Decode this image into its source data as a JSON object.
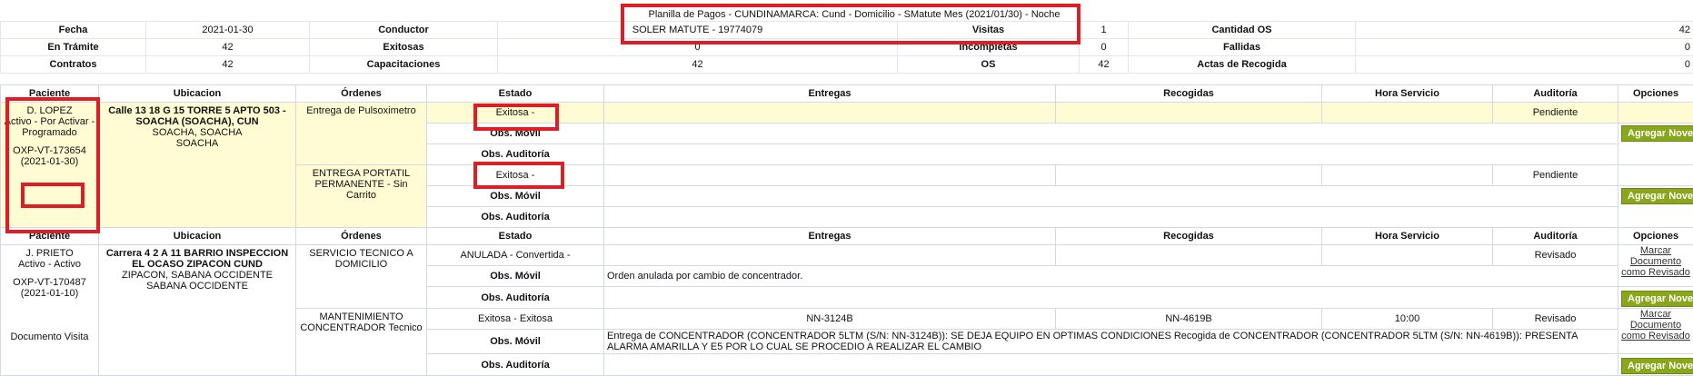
{
  "summary": {
    "title": "Planilla de Pagos - CUNDINAMARCA: Cund - Domicilio - SMatute Mes (2021/01/30) - Noche",
    "rows": [
      [
        "Fecha",
        "2021-01-30",
        "Conductor",
        "SOLER MATUTE - 19774079",
        "Visitas",
        "1",
        "Cantidad OS",
        "42"
      ],
      [
        "En Trámite",
        "42",
        "Exitosas",
        "0",
        "Incompletas",
        "0",
        "Fallidas",
        "0"
      ],
      [
        "Contratos",
        "42",
        "Capacitaciones",
        "42",
        "OS",
        "42",
        "Actas de Recogida",
        "0"
      ]
    ]
  },
  "headers": [
    "Paciente",
    "Ubicacion",
    "Órdenes",
    "Estado",
    "Entregas",
    "Recogidas",
    "Hora Servicio",
    "Auditoría",
    "Opciones"
  ],
  "obs_movil_label": "Obs. Móvil",
  "obs_auditoria_label": "Obs. Auditoría",
  "patients": [
    {
      "name": "D. LOPEZ",
      "status": "Activo - Por Activar - Programado",
      "code": "OXP-VT-173654",
      "date": "(2021-01-30)",
      "address_bold": "Calle 13 18 G 15 TORRE 5 APTO 503 - SOACHA (SOACHA), CUN",
      "address_city": "SOACHA, SOACHA",
      "address_region": "SOACHA",
      "orders": [
        {
          "name": "Entrega de Pulsoximetro",
          "estado": "Exitosa -",
          "entregas": "",
          "recogidas": "",
          "hora": "",
          "auditoria": "Pendiente",
          "obs_movil": "",
          "button": "Agregar Novedad"
        },
        {
          "name": "ENTREGA PORTATIL PERMANENTE - Sin Carrito",
          "estado": "Exitosa -",
          "entregas": "",
          "recogidas": "",
          "hora": "",
          "auditoria": "Pendiente",
          "obs_movil": "",
          "button": "Agregar Novedad"
        }
      ]
    },
    {
      "name": "J. PRIETO",
      "status": "Activo - Activo",
      "code": "OXP-VT-170487",
      "date": "(2021-01-10)",
      "doc": "Documento Visita",
      "address_bold": "Carrera 4 2 A 11 BARRIO INSPECCION EL OCASO ZIPACON CUND",
      "address_city": "ZIPACON, SABANA OCCIDENTE",
      "address_region": "SABANA OCCIDENTE",
      "orders": [
        {
          "name": "SERVICIO TECNICO A DOMICILIO",
          "estado": "ANULADA - Convertida -",
          "entregas": "",
          "recogidas": "",
          "hora": "",
          "auditoria": "Revisado",
          "link": "Marcar Documento como Revisado",
          "obs_movil": "Orden anulada por cambio de concentrador.",
          "button": "Agregar Novedad"
        },
        {
          "name": "MANTENIMIENTO CONCENTRADOR Tecnico",
          "estado": "Exitosa - Exitosa",
          "entregas": "NN-3124B",
          "recogidas": "NN-4619B",
          "hora": "10:00",
          "auditoria": "Revisado",
          "link": "Marcar Documento como Revisado",
          "obs_movil": "Entrega de CONCENTRADOR (CONCENTRADOR 5LTM (S/N: NN-3124B)): SE DEJA EQUIPO EN OPTIMAS CONDICIONES Recogida de CONCENTRADOR (CONCENTRADOR 5LTM (S/N: NN-4619B)): PRESENTA ALARMA AMARILLA Y E5 POR LO CUAL SE PROCEDIO A REALIZAR EL CAMBIO",
          "button": "Agregar Novedad"
        }
      ]
    }
  ]
}
